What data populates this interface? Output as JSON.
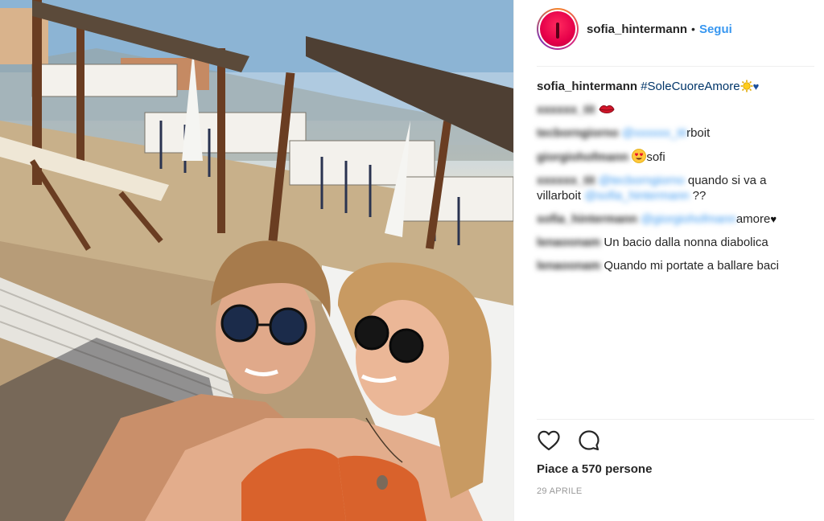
{
  "post": {
    "image_alt": "Selfie of a couple on a beach with striped sun loungers and wooden cabanas",
    "username": "sofia_hintermann",
    "separator": "•",
    "follow_label": "Segui"
  },
  "caption": {
    "username": "sofia_hintermann",
    "hashtag": "#SoleCuoreAmore",
    "emoji_sun": "sun-emoji",
    "emoji_heart": "♥"
  },
  "comments": [
    {
      "user": "xxxxxx_tit",
      "parts": [
        {
          "kind": "emoji",
          "value": "lips-emoji"
        }
      ]
    },
    {
      "user": "tecborngiorno",
      "mention": "@xxxxxx_tit",
      "text": "rboit"
    },
    {
      "user": "giorgiohofmann",
      "emoji": "heart-eyes-emoji",
      "text": "sofi"
    },
    {
      "user": "xxxxxx_tit",
      "mention": "@tecborngiorno",
      "text": "quando si va a villarboit",
      "mention2": "@sofia_hintermann",
      "text2": " ??"
    },
    {
      "user": "sofia_hintermann",
      "mention": "@giorgiohofmann",
      "text": "amore",
      "heart": "♥"
    },
    {
      "user": "lenaoonam",
      "text": "Un bacio dalla nonna diabolica"
    },
    {
      "user": "lenaoonam",
      "text": "Quando mi portate a ballare baci"
    }
  ],
  "actions": {
    "like_icon": "heart-outline-icon",
    "comment_icon": "comment-bubble-icon"
  },
  "likes_text": "Piace a 570 persone",
  "date_text": "29 APRILE",
  "colors": {
    "link_blue": "#3897f0",
    "hashtag_blue": "#003569",
    "text": "#262626",
    "muted": "#999999"
  }
}
